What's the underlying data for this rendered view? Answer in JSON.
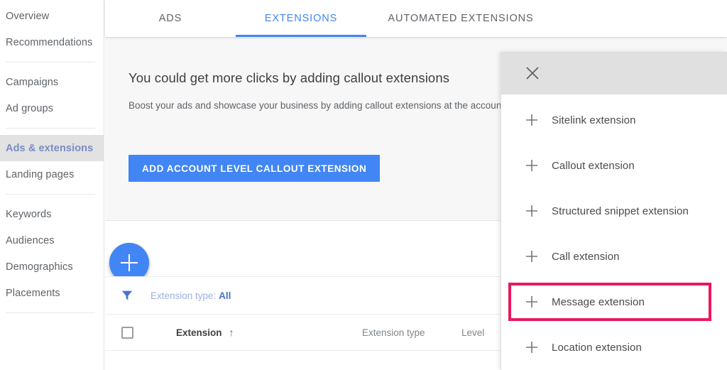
{
  "sidebar": {
    "items": [
      {
        "label": "Overview",
        "active": false,
        "sep_after": false
      },
      {
        "label": "Recommendations",
        "active": false,
        "sep_after": true
      },
      {
        "label": "Campaigns",
        "active": false,
        "sep_after": false
      },
      {
        "label": "Ad groups",
        "active": false,
        "sep_after": true
      },
      {
        "label": "Ads & extensions",
        "active": true,
        "sep_after": false
      },
      {
        "label": "Landing pages",
        "active": false,
        "sep_after": true
      },
      {
        "label": "Keywords",
        "active": false,
        "sep_after": false
      },
      {
        "label": "Audiences",
        "active": false,
        "sep_after": false
      },
      {
        "label": "Demographics",
        "active": false,
        "sep_after": false
      },
      {
        "label": "Placements",
        "active": false,
        "sep_after": true
      }
    ]
  },
  "tabs": {
    "items": [
      {
        "label": "ADS",
        "active": false
      },
      {
        "label": "EXTENSIONS",
        "active": true
      },
      {
        "label": "AUTOMATED EXTENSIONS",
        "active": false
      }
    ]
  },
  "promo": {
    "title": "You could get more clicks by adding callout extensions",
    "description": "Boost your ads and showcase your business by adding callout extensions at the account level.",
    "button_label": "ADD ACCOUNT LEVEL CALLOUT EXTENSION"
  },
  "fab": {
    "icon": "plus-icon",
    "label": "+"
  },
  "filter": {
    "icon": "filter-funnel-icon",
    "prefix": "Extension type:",
    "value": "All"
  },
  "table": {
    "columns": [
      {
        "key": "checkbox",
        "label": ""
      },
      {
        "key": "extension",
        "label": "Extension"
      },
      {
        "key": "extension_type",
        "label": "Extension type"
      },
      {
        "key": "level",
        "label": "Level"
      }
    ],
    "sort_indicator": "↑",
    "rows": []
  },
  "panel": {
    "close_icon": "close-icon",
    "items": [
      {
        "label": "Sitelink extension",
        "highlighted": false
      },
      {
        "label": "Callout extension",
        "highlighted": false
      },
      {
        "label": "Structured snippet extension",
        "highlighted": false
      },
      {
        "label": "Call extension",
        "highlighted": false
      },
      {
        "label": "Message extension",
        "highlighted": true
      },
      {
        "label": "Location extension",
        "highlighted": false
      }
    ]
  },
  "colors": {
    "accent_blue": "#4285f4",
    "tab_active_blue": "#4285f4",
    "highlight_pink": "#e8185c",
    "sidebar_active_bg": "#e2e2e2",
    "sidebar_active_text": "#7b8cc4",
    "panel_header_bg": "#e0e0e0",
    "promo_card_bg": "#f7f7f7",
    "text_primary": "#3c4043",
    "text_secondary": "#5f6368"
  }
}
